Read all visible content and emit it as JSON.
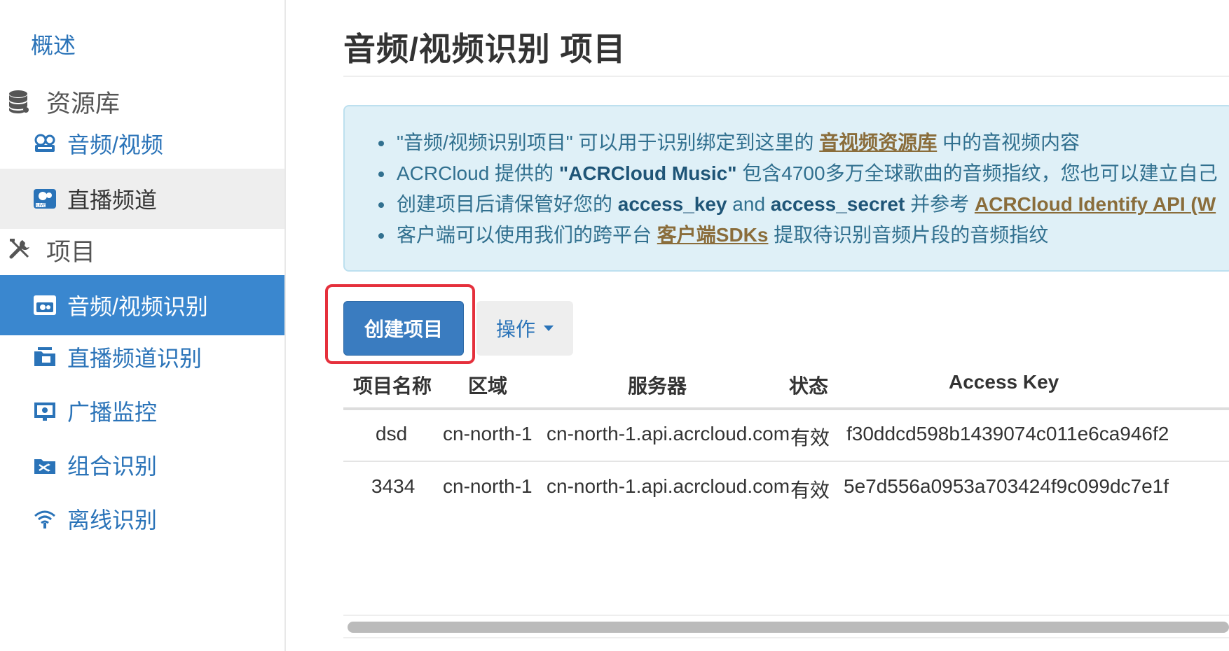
{
  "sidebar": {
    "overview": "概述",
    "library_section": "资源库",
    "library_items": [
      "音频/视频",
      "直播频道"
    ],
    "project_section": "项目",
    "project_items": [
      "音频/视频识别",
      "直播频道识别",
      "广播监控",
      "组合识别",
      "离线识别"
    ]
  },
  "main": {
    "title": "音频/视频识别 项目",
    "info": {
      "line1": {
        "a": "\"音频/视频识别项目\" 可以用于识别绑定到这里的 ",
        "link": "音视频资源库",
        "b": " 中的音视频内容"
      },
      "line2": {
        "a": "ACRCloud 提供的 ",
        "strong": "\"ACRCloud Music\"",
        "b": " 包含4700多万全球歌曲的音频指纹，您也可以建立自己"
      },
      "line3": {
        "a": "创建项目后请保管好您的 ",
        "strong1": "access_key",
        "mid": " and ",
        "strong2": "access_secret",
        "b": " 并参考 ",
        "link": "ACRCloud Identify API (W"
      },
      "line4": {
        "a": "客户端可以使用我们的跨平台 ",
        "link": "客户端SDKs",
        "b": " 提取待识别音频片段的音频指纹"
      }
    },
    "create_button": "创建项目",
    "actions_button": "操作",
    "table": {
      "headers": [
        "项目名称",
        "区域",
        "服务器",
        "状态",
        "Access Key"
      ],
      "rows": [
        [
          "dsd",
          "cn-north-1",
          "cn-north-1.api.acrcloud.com",
          "有效",
          "f30ddcd598b1439074c011e6ca946f2"
        ],
        [
          "3434",
          "cn-north-1",
          "cn-north-1.api.acrcloud.com",
          "有效",
          "5e7d556a0953a703424f9c099dc7e1f"
        ]
      ]
    }
  },
  "colors": {
    "accent": "#3a87cf",
    "button": "#3a7cc0",
    "info_bg": "#dff0f7",
    "highlight": "#e5303c",
    "link": "#8a6d3b"
  },
  "icons": [
    "database-icon",
    "film-reel-icon",
    "live-camera-icon",
    "tools-icon",
    "audio-video-folder-icon",
    "live-folder-icon",
    "broadcast-monitor-icon",
    "shuffle-folder-icon",
    "offline-wifi-icon"
  ]
}
